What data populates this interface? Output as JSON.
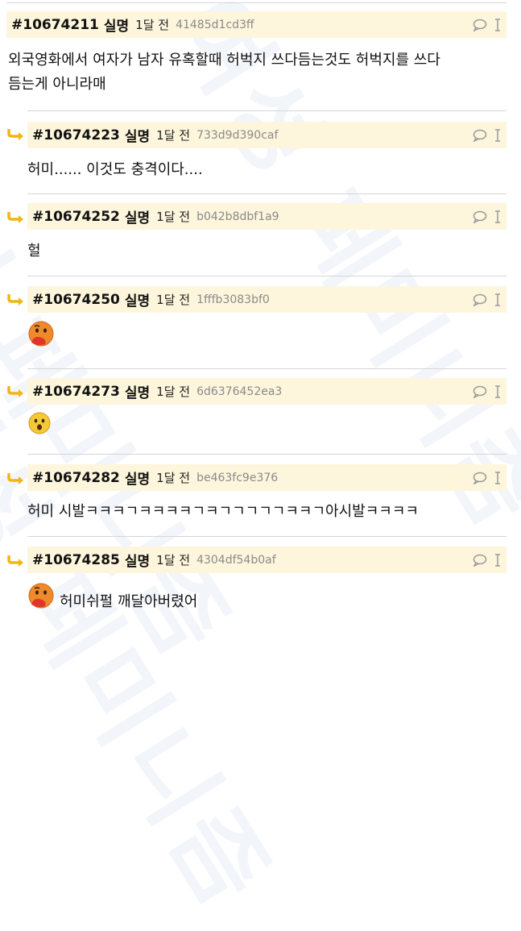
{
  "comments": [
    {
      "id": "#10674211",
      "author": "실명",
      "time": "1달 전",
      "hash": "41485d1cd3ff",
      "text_lines": [
        "외국영화에서 여자가 남자 유혹할때 허벅지 쓰다듬는것도 허벅지를 쓰다",
        "듬는게 아니라매"
      ],
      "is_reply": false
    },
    {
      "id": "#10674223",
      "author": "실명",
      "time": "1달 전",
      "hash": "733d9d390caf",
      "text": "허미...... 이것도 충격이다....",
      "is_reply": true
    },
    {
      "id": "#10674252",
      "author": "실명",
      "time": "1달 전",
      "hash": "b042b8dbf1a9",
      "text": "헐",
      "is_reply": true
    },
    {
      "id": "#10674250",
      "author": "실명",
      "time": "1달 전",
      "hash": "1fffb3083bf0",
      "emoji": "thinking-face-emoji",
      "is_reply": true
    },
    {
      "id": "#10674273",
      "author": "실명",
      "time": "1달 전",
      "hash": "6d6376452ea3",
      "emoji": "shocked-face-emoji",
      "is_reply": true
    },
    {
      "id": "#10674282",
      "author": "실명",
      "time": "1달 전",
      "hash": "be463fc9e376",
      "text": "허미 시발ㅋㅋㅋㄱㅋㅋㅋㅋㄱㅋㄱㄱㄱㄱㄱㅋㅋㄱ아시발ㅋㅋㅋㅋ",
      "is_reply": true
    },
    {
      "id": "#10674285",
      "author": "실명",
      "time": "1달 전",
      "hash": "4304df54b0af",
      "text": "허미쉬펄 깨달아버렸어",
      "emoji": "thinking-face-emoji",
      "is_reply": true
    }
  ],
  "colors": {
    "header_bg": "#fdf6dc",
    "reply_arrow": "#f2b614",
    "separator": "#d6d6d6"
  },
  "icons": {
    "reply": "speech-bubble-icon",
    "report": "cursor-i-icon",
    "reply_arrow": "reply-arrow-icon"
  }
}
